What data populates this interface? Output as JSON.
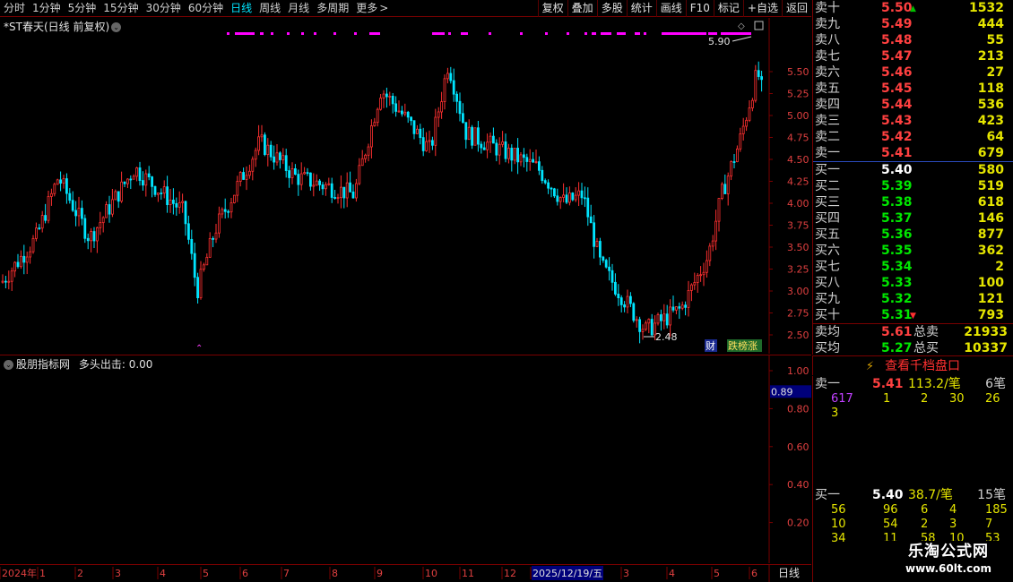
{
  "toolbar": {
    "periods": [
      "分时",
      "1分钟",
      "5分钟",
      "15分钟",
      "30分钟",
      "60分钟",
      "日线",
      "周线",
      "月线",
      "多周期",
      "更多"
    ],
    "active_period": "日线",
    "buttons": [
      "复权",
      "叠加",
      "多股",
      "统计",
      "画线",
      "F10",
      "标记",
      "+自选",
      "返回"
    ]
  },
  "main_chart": {
    "title": "*ST春天(日线 前复权)",
    "high_label": "5.90",
    "low_label": "2.48",
    "badge_cai": "财",
    "badge_rank": "跌榜涨",
    "y_ticks": [
      "5.50",
      "5.25",
      "5.00",
      "4.75",
      "4.50",
      "4.25",
      "4.00",
      "3.75",
      "3.50",
      "3.25",
      "3.00",
      "2.75",
      "2.50"
    ]
  },
  "indicator": {
    "title": "股朋指标网",
    "metric_label": "多头出击:",
    "metric_value": "0.00",
    "current_value": "0.89",
    "y_ticks": [
      "1.00",
      "0.80",
      "0.60",
      "0.40",
      "0.20"
    ]
  },
  "date_axis": {
    "labels": [
      "2024年",
      "1",
      "2",
      "3",
      "4",
      "5",
      "6",
      "7",
      "8",
      "9",
      "10",
      "11",
      "12",
      "2025/12/19/五",
      "3",
      "4",
      "5",
      "6"
    ],
    "period_label": "日线"
  },
  "order_book": {
    "asks": [
      {
        "label": "卖十",
        "price": "5.50",
        "volume": "1532"
      },
      {
        "label": "卖九",
        "price": "5.49",
        "volume": "444"
      },
      {
        "label": "卖八",
        "price": "5.48",
        "volume": "55"
      },
      {
        "label": "卖七",
        "price": "5.47",
        "volume": "213"
      },
      {
        "label": "卖六",
        "price": "5.46",
        "volume": "27"
      },
      {
        "label": "卖五",
        "price": "5.45",
        "volume": "118"
      },
      {
        "label": "卖四",
        "price": "5.44",
        "volume": "536"
      },
      {
        "label": "卖三",
        "price": "5.43",
        "volume": "423"
      },
      {
        "label": "卖二",
        "price": "5.42",
        "volume": "64"
      },
      {
        "label": "卖一",
        "price": "5.41",
        "volume": "679"
      }
    ],
    "bids": [
      {
        "label": "买一",
        "price": "5.40",
        "volume": "580"
      },
      {
        "label": "买二",
        "price": "5.39",
        "volume": "519"
      },
      {
        "label": "买三",
        "price": "5.38",
        "volume": "618"
      },
      {
        "label": "买四",
        "price": "5.37",
        "volume": "146"
      },
      {
        "label": "买五",
        "price": "5.36",
        "volume": "877"
      },
      {
        "label": "买六",
        "price": "5.35",
        "volume": "362"
      },
      {
        "label": "买七",
        "price": "5.34",
        "volume": "2"
      },
      {
        "label": "买八",
        "price": "5.33",
        "volume": "100"
      },
      {
        "label": "买九",
        "price": "5.32",
        "volume": "121"
      },
      {
        "label": "买十",
        "price": "5.31",
        "volume": "793"
      }
    ],
    "summary": [
      {
        "label": "卖均",
        "price": "5.61",
        "total_label": "总卖",
        "total": "21933"
      },
      {
        "label": "买均",
        "price": "5.27",
        "total_label": "总买",
        "total": "10337"
      }
    ]
  },
  "deep_book": {
    "label": "查看千档盘口"
  },
  "queue": {
    "ask": {
      "label": "卖一",
      "price": "5.41",
      "avg": "113.2/笔",
      "count": "6笔",
      "rows": [
        [
          "617",
          "1",
          "2",
          "30",
          "26"
        ],
        [
          "3"
        ]
      ]
    },
    "bid": {
      "label": "买一",
      "price": "5.40",
      "avg": "38.7/笔",
      "count": "15笔",
      "rows": [
        [
          "56",
          "96",
          "6",
          "4",
          "185"
        ],
        [
          "10",
          "54",
          "2",
          "3",
          "7"
        ],
        [
          "34",
          "11",
          "58",
          "10",
          "53"
        ]
      ]
    }
  },
  "watermark": {
    "title": "乐淘公式网",
    "url": "www.60lt.com"
  },
  "colors": {
    "up": "#ff3030",
    "down": "#00e5ff",
    "grid": "#7a0000",
    "accent": "#ff00ff"
  }
}
